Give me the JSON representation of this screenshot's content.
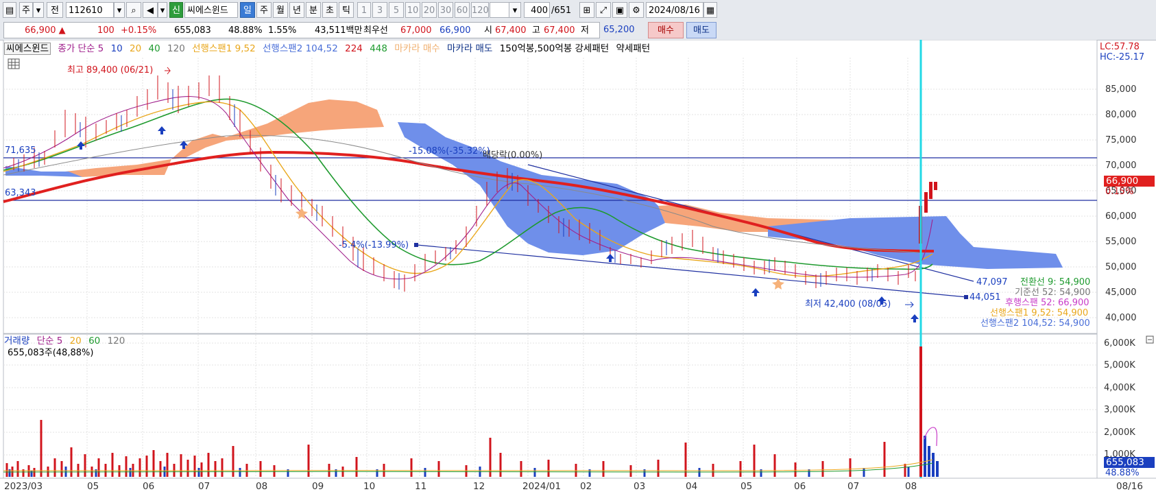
{
  "toolbar": {
    "period": "주",
    "prev": "전",
    "code": "112610",
    "stock_name": "씨에스윈드",
    "new_btn": "신",
    "tabs": [
      "일",
      "주",
      "월",
      "년",
      "분",
      "초",
      "틱"
    ],
    "minutes": [
      "1",
      "3",
      "5",
      "10",
      "20",
      "30",
      "60",
      "120"
    ],
    "count": "400",
    "total": "/651",
    "date": "2024/08/16"
  },
  "quote": {
    "price": "66,900 ▲",
    "change": "100",
    "rate": "+0.15%",
    "volume": "655,083",
    "vol_ratio": "48.88%",
    "turnover": "1.55%",
    "amount": "43,511백만",
    "best_label": "최우선",
    "best_ask": "67,000",
    "best_bid": "66,900",
    "open_label": "시",
    "open": "67,400",
    "high_label": "고",
    "high": "67,400",
    "low_label": "저",
    "low": "65,200",
    "buy": "매수",
    "sell": "매도"
  },
  "legend": {
    "name": "씨에스윈드",
    "ma_label": "종가 단순 5",
    "ma10": "10",
    "ma20": "20",
    "ma40": "40",
    "ma120": "120",
    "span1": "선행스팬1 9,52",
    "span2": "선행스팬2 104,52",
    "ma224": "224",
    "ma448": "448",
    "macara_buy": "마카라 매수",
    "macara_sell": "마카라 매도",
    "pattern": "150억봉,500억봉 강세패턴",
    "weak": "약세패턴"
  },
  "vlegend": {
    "name": "거래량",
    "ma_label": "단순 5",
    "m20": "20",
    "m60": "60",
    "m120": "120",
    "summary": "655,083주(48,88%)"
  },
  "annotations": {
    "high": "최고 89,400 (06/21)",
    "low": "최저 42,400 (08/05)",
    "left_top": "71,635",
    "left_mid": "63,343",
    "pct1": "-15.08%(-35.32%)",
    "pct2": "배당락(0.00%)",
    "pct3": "-5.4%(-13.99%)",
    "trend1": "47,097",
    "trend2": "44,051",
    "conv": "전환선 9: 54,900",
    "base": "기준선 52: 54,900",
    "lag": "후행스팬 52: 66,900",
    "lead1": "선행스팬1 9,52: 54,900",
    "lead2": "선행스팬2 104,52: 54,900"
  },
  "right_axis": {
    "lc": "LC:57.78",
    "hc": "HC:-25.17",
    "price_ticks": [
      "85,000",
      "80,000",
      "75,000",
      "70,000",
      "65,000",
      "60,000",
      "55,000",
      "50,000",
      "45,000",
      "40,000"
    ],
    "cur_price": "66,900",
    "cur_rate": "0.15%",
    "vol_ticks": [
      "6,000K",
      "5,000K",
      "4,000K",
      "3,000K",
      "2,000K",
      "1,000K"
    ],
    "cur_vol": "655,083",
    "cur_vol_ratio": "48.88%"
  },
  "x_axis": [
    "2023/03",
    "05",
    "06",
    "07",
    "08",
    "09",
    "10",
    "11",
    "12",
    "2024/01",
    "02",
    "03",
    "04",
    "05",
    "06",
    "07",
    "08"
  ],
  "x_axis_right": "08/16",
  "colors": {
    "up": "#d1141c",
    "down": "#1a3fbf",
    "cloud_orange": "#f6a57a",
    "cloud_blue": "#6f8fea",
    "cyan": "#22d8e6"
  }
}
